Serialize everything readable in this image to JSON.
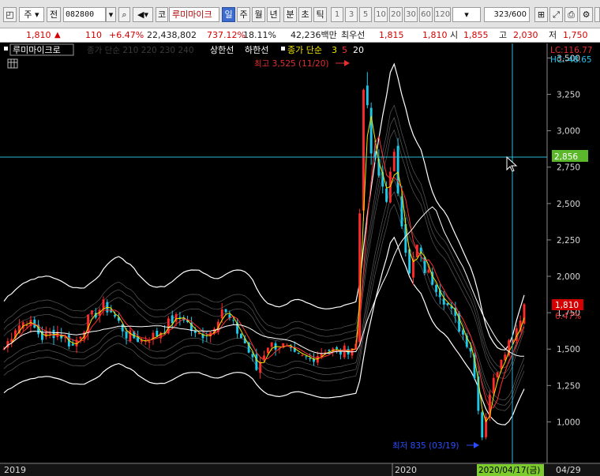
{
  "toolbar": {
    "market": "주",
    "type": "전",
    "code": "082800",
    "name_prefix": "코",
    "name": "루미마이크",
    "periods": [
      "일",
      "주",
      "월",
      "년",
      "분",
      "초",
      "틱"
    ],
    "counts": [
      "1",
      "3",
      "5",
      "10",
      "20",
      "30",
      "60",
      "120"
    ],
    "counter": "323/600"
  },
  "quote": {
    "price": "1,810",
    "change": "110",
    "change_pct": "+6.47%",
    "volume": "22,438,802",
    "volume_ratio": "737.12%",
    "turnover": "18.11%",
    "amount": "42,236백만",
    "bid_label": "최우선",
    "bid": "1,815",
    "ask": "1,810",
    "open_label": "시",
    "open": "1,855",
    "high_label": "고",
    "high": "2,030",
    "low_label": "저",
    "low": "1,750"
  },
  "legend": {
    "stock": "루미마이크로",
    "ma_env": "종가 단순 210 220 230 240",
    "upper": "상한선",
    "lower": "하한선",
    "ma_label": "종가 단순",
    "ma3": "3",
    "ma5": "5",
    "ma20": "20"
  },
  "annotations": {
    "high": "최고 3,525 (11/20)",
    "low": "최저 835 (03/19)",
    "lc": "LC:116.77",
    "hc": "HC:-48.65"
  },
  "chart_data": {
    "type": "candlestick",
    "y_ticks": [
      1000,
      1250,
      1500,
      1750,
      2000,
      2250,
      2500,
      2750,
      3000,
      3250,
      3500
    ],
    "y_tick_labels": [
      "1,000",
      "1,250",
      "1,500",
      "1,750",
      "2,000",
      "2,250",
      "2,500",
      "2,750",
      "3,000",
      "3,250",
      "3,500"
    ],
    "ylim": [
      715,
      3600
    ],
    "x_labels": [
      "2019",
      "2020",
      "04/29"
    ],
    "crosshair": {
      "price": "2,856",
      "date": "2020/04/17(금)"
    },
    "current_price": {
      "price": "1,810",
      "pct": "6.47%"
    },
    "price_path": [
      [
        0,
        1500
      ],
      [
        3,
        1650
      ],
      [
        6,
        1700
      ],
      [
        10,
        1580
      ],
      [
        14,
        1620
      ],
      [
        18,
        1520
      ],
      [
        22,
        1700
      ],
      [
        26,
        1800
      ],
      [
        28,
        1760
      ],
      [
        32,
        1600
      ],
      [
        36,
        1560
      ],
      [
        40,
        1600
      ],
      [
        44,
        1700
      ],
      [
        47,
        1720
      ],
      [
        50,
        1590
      ],
      [
        54,
        1620
      ],
      [
        57,
        1780
      ],
      [
        59,
        1700
      ],
      [
        63,
        1540
      ],
      [
        66,
        1360
      ],
      [
        69,
        1530
      ],
      [
        73,
        1520
      ],
      [
        76,
        1450
      ],
      [
        80,
        1430
      ],
      [
        84,
        1500
      ],
      [
        88,
        1480
      ],
      [
        90,
        1500
      ],
      [
        92,
        1530
      ],
      [
        94,
        3350
      ],
      [
        96,
        2850
      ],
      [
        98,
        2680
      ],
      [
        100,
        2560
      ],
      [
        102,
        2800
      ],
      [
        104,
        2400
      ],
      [
        106,
        2000
      ],
      [
        108,
        2200
      ],
      [
        110,
        2050
      ],
      [
        114,
        1900
      ],
      [
        118,
        1700
      ],
      [
        122,
        1500
      ],
      [
        125,
        900
      ],
      [
        127,
        1200
      ],
      [
        130,
        1450
      ],
      [
        134,
        1650
      ],
      [
        136,
        1810
      ]
    ]
  }
}
